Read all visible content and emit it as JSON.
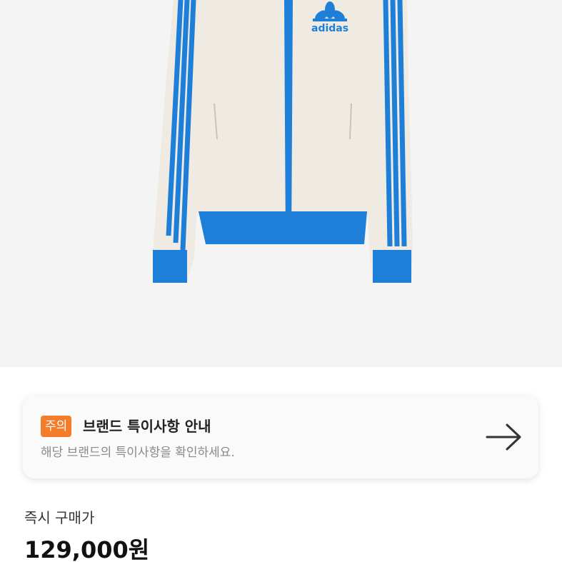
{
  "product": {
    "image_alt_icon": "track-jacket-image",
    "brand_logo_text": "adidas",
    "colors": {
      "jacket_body": "#efebe3",
      "jacket_trim": "#1e7fd8"
    }
  },
  "notice": {
    "badge": "주의",
    "badge_color": "#f47d2a",
    "title": "브랜드 특이사항 안내",
    "subtitle": "해당 브랜드의 특이사항을 확인하세요.",
    "arrow_icon": "arrow-right-icon"
  },
  "price": {
    "label": "즉시 구매가",
    "value": "129,000원"
  }
}
